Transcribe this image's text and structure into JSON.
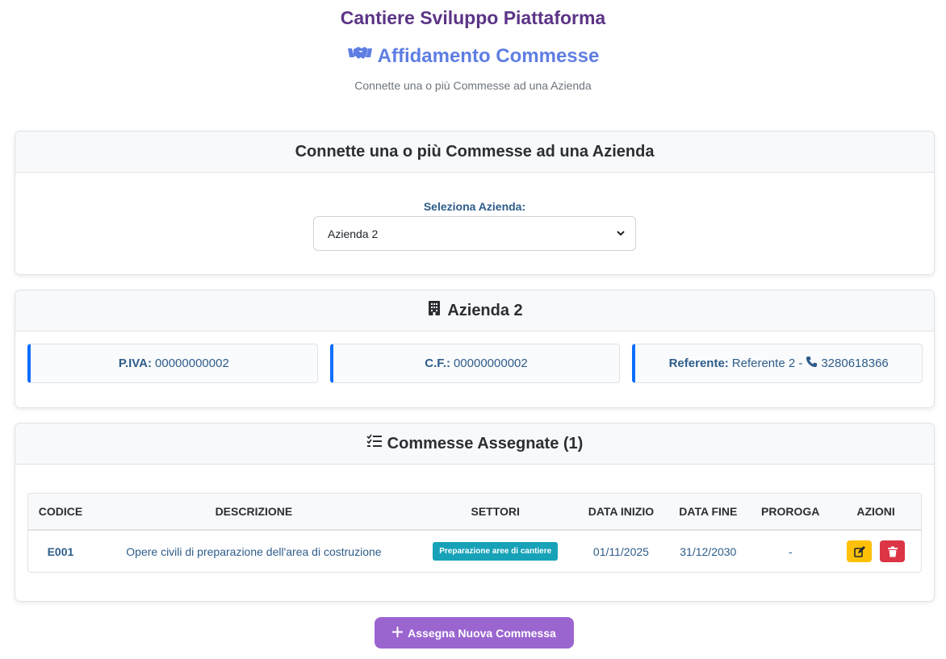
{
  "app": {
    "title": "Cantiere Sviluppo Piattaforma"
  },
  "page": {
    "title": "Affidamento Commesse",
    "subtitle": "Connette una o più Commesse ad una Azienda"
  },
  "connect_card": {
    "header": "Connette una o più Commesse ad una Azienda",
    "select_label": "Seleziona Azienda:",
    "selected_value": "Azienda 2"
  },
  "azienda_card": {
    "header": "Azienda 2",
    "piva_label": "P.IVA:",
    "piva_value": "00000000002",
    "cf_label": "C.F.:",
    "cf_value": "00000000002",
    "referente_label": "Referente:",
    "referente_value": "Referente 2 -",
    "phone": "3280618366"
  },
  "commesse_card": {
    "header": "Commesse Assegnate (1)",
    "columns": [
      "CODICE",
      "DESCRIZIONE",
      "SETTORI",
      "DATA INIZIO",
      "DATA FINE",
      "PROROGA",
      "AZIONI"
    ],
    "rows": [
      {
        "codice": "E001",
        "descrizione": "Opere civili di preparazione dell'area di costruzione",
        "settore": "Preparazione aree di cantiere",
        "data_inizio": "01/11/2025",
        "data_fine": "31/12/2030",
        "proroga": "-"
      }
    ]
  },
  "actions": {
    "assign_new": "Assegna Nuova Commessa"
  },
  "icons": {
    "page_title": "handshake-icon",
    "azienda": "building-icon",
    "commesse": "list-check-icon",
    "phone": "phone-icon",
    "edit": "edit-icon",
    "delete": "trash-icon",
    "add": "plus-icon"
  },
  "colors": {
    "brand": "#5b3486",
    "title": "#5f7ee3",
    "accent": "#0d6efd",
    "badge": "#17a2b8",
    "primary_button": "#9b65d0",
    "edit": "#ffc107",
    "delete": "#dc3545"
  }
}
